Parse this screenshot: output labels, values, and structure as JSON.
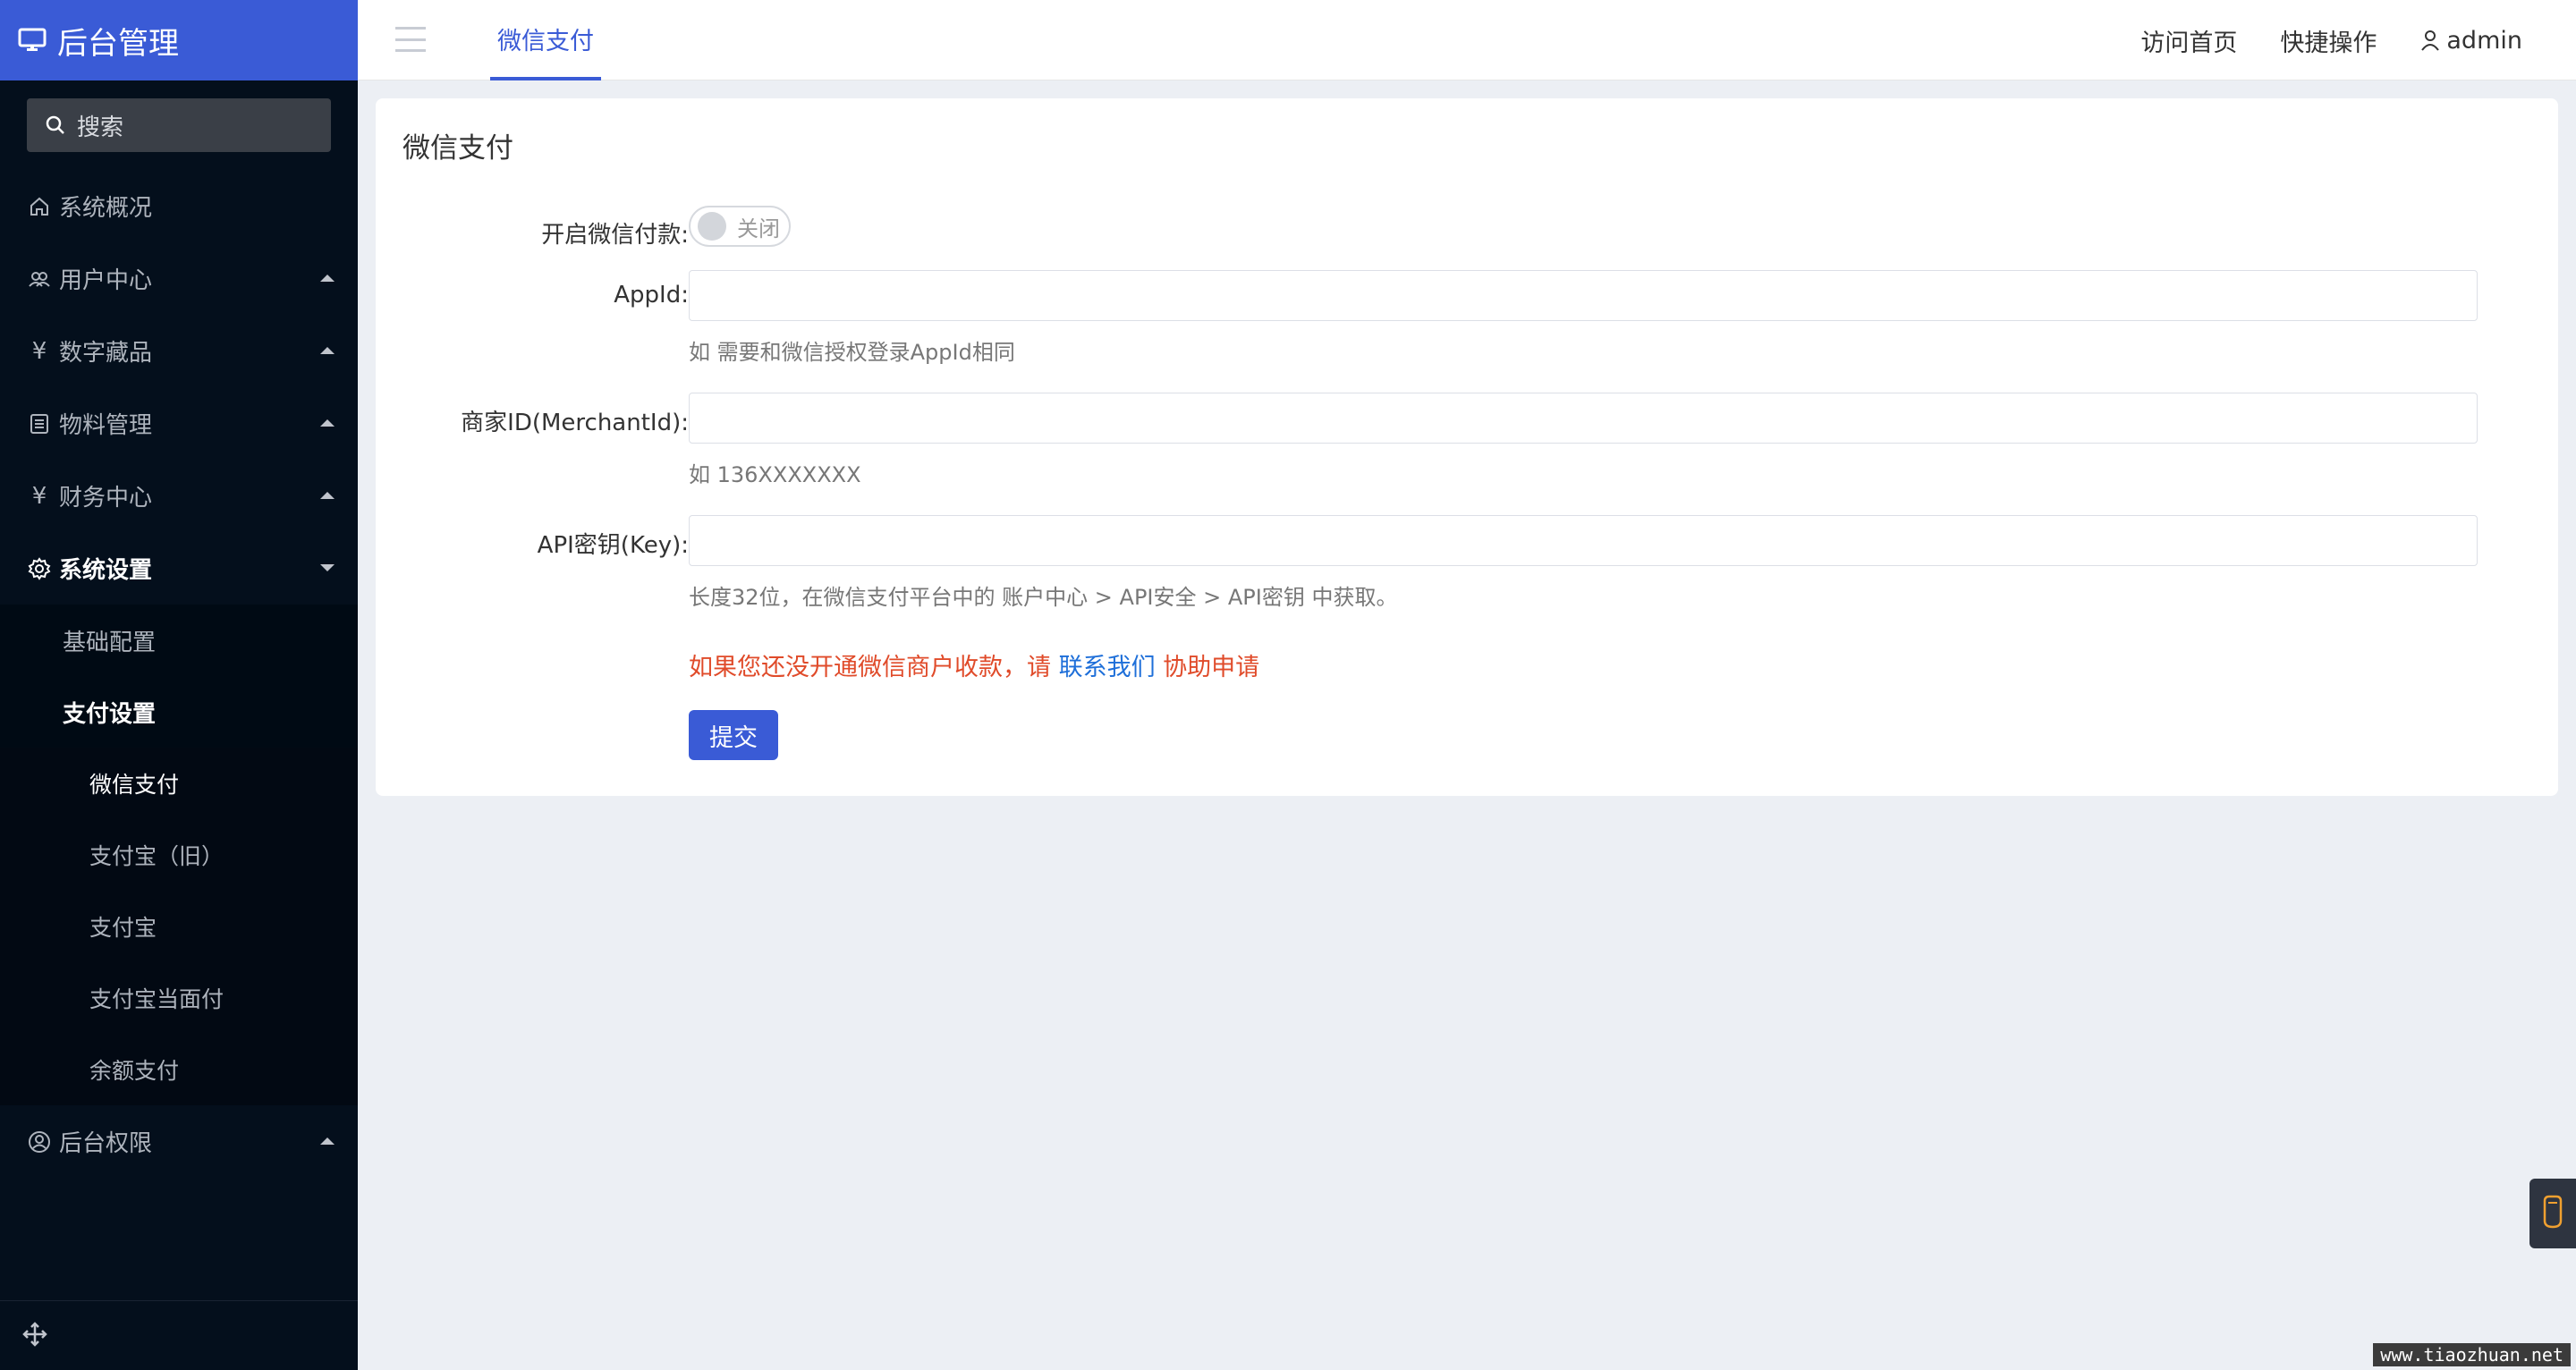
{
  "brand": {
    "title": "后台管理",
    "icon": "monitor-icon"
  },
  "search": {
    "label": "搜索"
  },
  "sidebar": {
    "items": [
      {
        "label": "系统概况",
        "icon": "home-icon"
      },
      {
        "label": "用户中心",
        "icon": "users-icon"
      },
      {
        "label": "数字藏品",
        "icon": "yen-icon"
      },
      {
        "label": "物料管理",
        "icon": "list-icon"
      },
      {
        "label": "财务中心",
        "icon": "yen-icon"
      },
      {
        "label": "系统设置",
        "icon": "gear-icon"
      },
      {
        "label": "后台权限",
        "icon": "user-circle-icon"
      }
    ],
    "settings_sub": {
      "basic": "基础配置",
      "payment": "支付设置",
      "payment_children": [
        "微信支付",
        "支付宝（旧）",
        "支付宝",
        "支付宝当面付",
        "余额支付"
      ]
    }
  },
  "header": {
    "tab": "微信支付",
    "links": {
      "home": "访问首页",
      "quick": "快捷操作",
      "user": "admin"
    }
  },
  "form": {
    "title": "微信支付",
    "enable_label": "开启微信付款:",
    "enable_state": "关闭",
    "appid_label": "AppId:",
    "appid_value": "",
    "appid_hint": "如 需要和微信授权登录AppId相同",
    "merchant_label": "商家ID(MerchantId):",
    "merchant_value": "",
    "merchant_hint": "如 136XXXXXXX",
    "key_label": "API密钥(Key):",
    "key_value": "",
    "key_hint": "长度32位，在微信支付平台中的 账户中心 > API安全 > API密钥 中获取。",
    "notice_pre": "如果您还没开通微信商户收款，请 ",
    "notice_link": "联系我们",
    "notice_post": " 协助申请",
    "submit": "提交"
  },
  "watermark": "www.tiaozhuan.net",
  "colors": {
    "accent": "#3a5bd6",
    "sidebar_bg": "#040f1c",
    "notice_red": "#e04b2a",
    "link_blue": "#1e6fd9"
  }
}
